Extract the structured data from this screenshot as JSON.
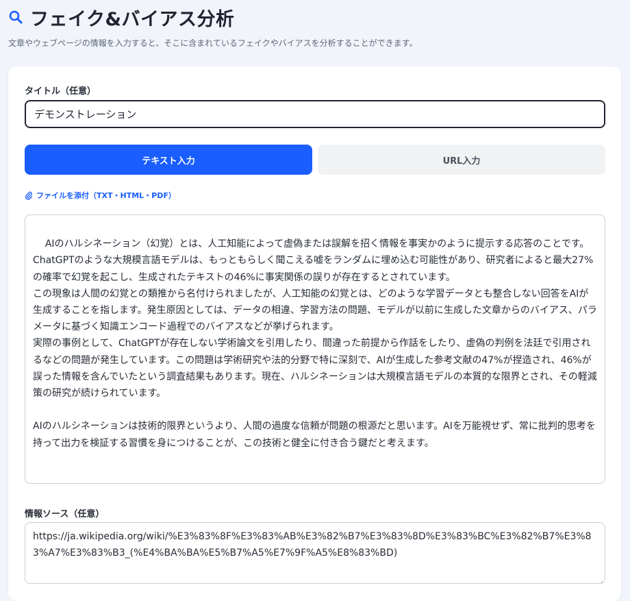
{
  "header": {
    "title": "フェイク&バイアス分析",
    "subtitle": "文章やウェブページの情報を入力すると、そこに含まれているフェイクやバイアスを分析することができます。",
    "icon": "search-icon"
  },
  "form": {
    "title_label": "タイトル（任意）",
    "title_value": "デモンストレーション",
    "tabs": [
      {
        "label": "テキスト入力",
        "active": true
      },
      {
        "label": "URL入力",
        "active": false
      }
    ],
    "attach_label": "ファイルを添付（TXT・HTML・PDF）",
    "body_text": "AIのハルシネーション（幻覚）とは、人工知能によって虚偽または誤解を招く情報を事実かのように提示する応答のことです。 ChatGPTのような大規模言語モデルは、もっともらしく聞こえる嘘をランダムに埋め込む可能性があり、研究者によると最大27%の確率で幻覚を起こし、生成されたテキストの46%に事実関係の誤りが存在するとされています。\nこの現象は人間の幻覚との類推から名付けられましたが、人工知能の幻覚とは、どのような学習データとも整合しない回答をAIが生成することを指します。発生原因としては、データの相違、学習方法の問題、モデルが以前に生成した文章からのバイアス、パラメータに基づく知識エンコード過程でのバイアスなどが挙げられます。\n実際の事例として、ChatGPTが存在しない学術論文を引用したり、間違った前提から作話をしたり、虚偽の判例を法廷で引用されるなどの問題が発生しています。この問題は学術研究や法的分野で特に深刻で、AIが生成した参考文献の47%が捏造され、46%が誤った情報を含んでいたという調査結果もあります。現在、ハルシネーションは大規模言語モデルの本質的な限界とされ、その軽減策の研究が続けられています。\n\nAIのハルシネーションは技術的限界というより、人間の過度な信頼が問題の根源だと思います。AIを万能視せず、常に批判的思考を持って出力を検証する習慣を身につけることが、この技術と健全に付き合う鍵だと考えます。",
    "source_label": "情報ソース（任意）",
    "source_value": "https://ja.wikipedia.org/wiki/%E3%83%8F%E3%83%AB%E3%82%B7%E3%83%8D%E3%83%BC%E3%82%B7%E3%83%A7%E3%83%B3_(%E4%BA%BA%E5%B7%A5%E7%9F%A5%E8%83%BD)"
  },
  "colors": {
    "accent": "#1a5eff",
    "background": "#f1f4fb",
    "card": "#ffffff",
    "inactive_tab": "#f1f2f4"
  }
}
